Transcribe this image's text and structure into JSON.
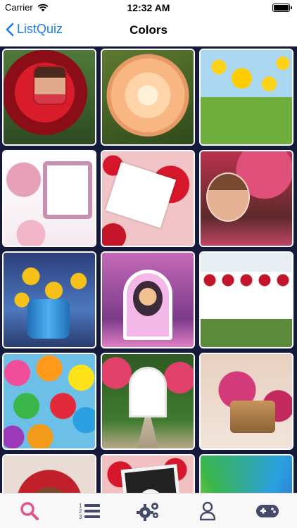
{
  "status": {
    "carrier": "Carrier",
    "time": "12:32 AM",
    "battery_level": 1.0
  },
  "nav": {
    "back_label": "ListQuiz",
    "title": "Colors"
  },
  "accent_color": "#1a7cf5",
  "tab_active_color": "#e0508a",
  "tabs": [
    {
      "icon": "search-icon",
      "active": true
    },
    {
      "icon": "numbered-list-icon",
      "active": false
    },
    {
      "icon": "gears-icon",
      "active": false
    },
    {
      "icon": "person-icon",
      "active": false
    },
    {
      "icon": "gamepad-icon",
      "active": false
    }
  ],
  "tiles": [
    {
      "subject": "red-rose-photo-frame"
    },
    {
      "subject": "peach-rose"
    },
    {
      "subject": "yellow-flowers-field"
    },
    {
      "subject": "pink-roses-frame"
    },
    {
      "subject": "red-roses-card"
    },
    {
      "subject": "blossom-tree-portrait-frame"
    },
    {
      "subject": "yellow-flowers-blue-vase"
    },
    {
      "subject": "neon-arch-portrait"
    },
    {
      "subject": "wedding-stage"
    },
    {
      "subject": "colorful-umbrellas"
    },
    {
      "subject": "garden-gate"
    },
    {
      "subject": "pink-flowers-camera"
    },
    {
      "subject": "roses-arch-portrait"
    },
    {
      "subject": "red-roses-camera-frame"
    },
    {
      "subject": "colored-pencils"
    }
  ]
}
